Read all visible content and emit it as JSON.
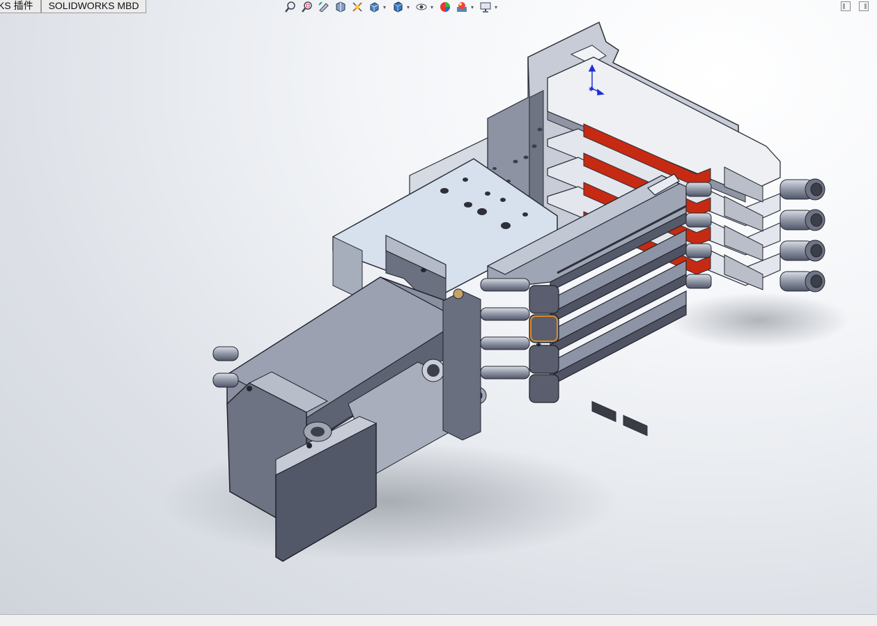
{
  "tabs": [
    {
      "label": "KS 插件"
    },
    {
      "label": "SOLIDWORKS MBD"
    }
  ],
  "view_toolbar": {
    "buttons": [
      {
        "icon": "zoom-to-fit-icon"
      },
      {
        "icon": "zoom-to-area-icon"
      },
      {
        "icon": "previous-view-icon"
      },
      {
        "icon": "section-view-icon"
      },
      {
        "icon": "dynamic-annotation-icon"
      },
      {
        "icon": "view-orientation-icon"
      },
      {
        "icon": "display-style-icon"
      },
      {
        "icon": "hide-show-items-icon"
      },
      {
        "icon": "edit-appearance-icon"
      },
      {
        "icon": "apply-scene-icon"
      },
      {
        "icon": "view-settings-icon"
      }
    ]
  },
  "window_controls": [
    {
      "icon": "tile-left-icon"
    },
    {
      "icon": "tile-right-icon"
    }
  ],
  "colors": {
    "background_light": "#ffffff",
    "background_dark": "#cfd4db",
    "part_body": "#9aa1b2",
    "part_dark": "#4b4f5e",
    "accent_red": "#c62a12",
    "selection_orange": "#e08a2a",
    "triad_blue": "#1c2fd8"
  }
}
